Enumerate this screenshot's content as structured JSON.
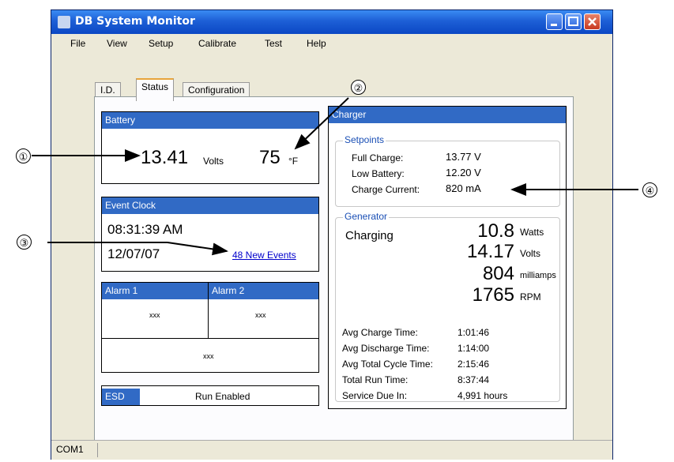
{
  "window": {
    "title": "DB System Monitor"
  },
  "menu": [
    "File",
    "View",
    "Setup",
    "Calibrate",
    "Test",
    "Help"
  ],
  "tabs": [
    "I.D.",
    "Status",
    "Configuration"
  ],
  "battery": {
    "header": "Battery",
    "volts": "13.41",
    "volts_unit": "Volts",
    "temp": "75",
    "temp_unit": "°F"
  },
  "event_clock": {
    "header": "Event Clock",
    "time": "08:31:39 AM",
    "date": "12/07/07",
    "events_link": "48 New Events"
  },
  "alarms": {
    "alarm1": "Alarm 1",
    "alarm2": "Alarm 2",
    "val1": "xxx",
    "val2": "xxx",
    "val3": "xxx"
  },
  "esd": {
    "label": "ESD",
    "status": "Run Enabled"
  },
  "charger": {
    "header": "Charger",
    "setpoints_title": "Setpoints",
    "full_charge_label": "Full Charge:",
    "full_charge": "13.77 V",
    "low_battery_label": "Low Battery:",
    "low_battery": "12.20 V",
    "charge_current_label": "Charge Current:",
    "charge_current": "820 mA",
    "generator_title": "Generator",
    "state": "Charging",
    "watts": "10.8",
    "watts_unit": "Watts",
    "volts": "14.17",
    "volts_unit": "Volts",
    "milliamps": "804",
    "milliamps_unit": "milliamps",
    "rpm": "1765",
    "rpm_unit": "RPM",
    "avg_charge_label": "Avg Charge Time:",
    "avg_charge": "1:01:46",
    "avg_discharge_label": "Avg Discharge Time:",
    "avg_discharge": "1:14:00",
    "avg_total_label": "Avg Total Cycle Time:",
    "avg_total": "2:15:46",
    "total_run_label": "Total Run Time:",
    "total_run": "8:37:44",
    "service_label": "Service Due In:",
    "service": "4,991 hours"
  },
  "statusbar": {
    "port": "COM1"
  },
  "callouts": [
    "①",
    "②",
    "③",
    "④"
  ]
}
